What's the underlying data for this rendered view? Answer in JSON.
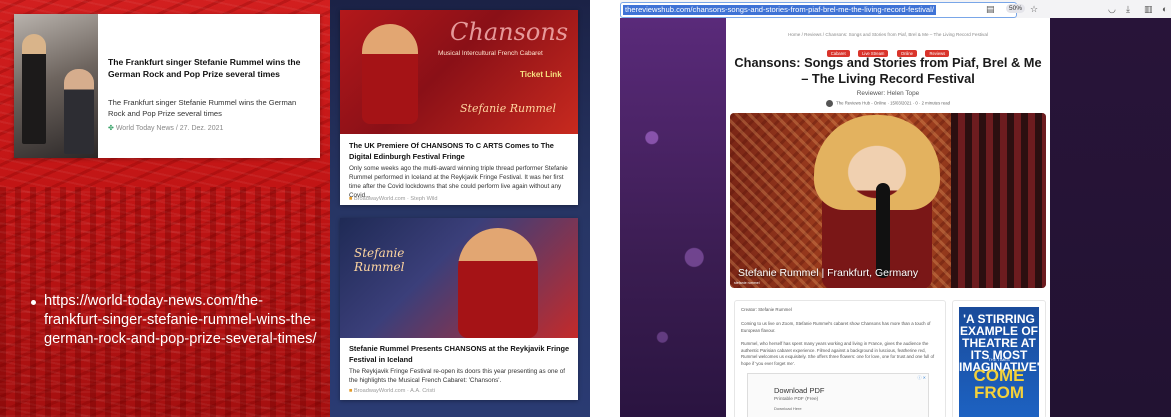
{
  "left_slide": {
    "top_card": {
      "title": "The Frankfurt singer Stefanie Rummel wins the German Rock and Pop Prize several times",
      "description": "The Frankfurt singer Stefanie Rummel wins the German Rock and Pop Prize several times",
      "source": "World Today News",
      "date": "27. Dez. 2021"
    },
    "bullet_link": "https://world-today-news.com/the-frankfurt-singer-stefanie-rummel-wins-the-german-rock-and-pop-prize-several-times/",
    "card1": {
      "image_brand": "Chansons",
      "image_subtitle": "Musical Intercultural French Cabaret",
      "image_ticket": "Ticket Link",
      "image_signature": "Stefanie Rummel",
      "title": "The UK Premiere Of CHANSONS To C ARTS Comes to The Digital Edinburgh Festival Fringe",
      "description": "Only some weeks ago the multi-award winning triple thread performer Stefanie Rummel performed in Iceland at the Reykjavik Fringe Festival. It was her first time after the Covid lockdowns that she could perform live again without any Covid...",
      "source": "BroadwayWorld.com · Steph Wild"
    },
    "card2": {
      "image_signature": "Stefanie Rummel",
      "title": "Stefanie Rummel Presents CHANSONS at the Reykjavik Fringe Festival in Iceland",
      "description": "The Reykjavik Fringe Festival re-open its doors this year presenting as one of the highlights the Musical French Cabaret: 'Chansons'.",
      "source": "BroadwayWorld.com · A.A. Cristi"
    }
  },
  "browser": {
    "url": "thereviewshub.com/chansons-songs-and-stories-from-piaf-brel-me-the-living-record-festival/",
    "zoom": "50%",
    "page": {
      "breadcrumb": "Home / Reviews / Chansons: Songs and Stories from Piaf, Brel & Me – The Living Record Festival",
      "tags": [
        "Cabaret",
        "Live Stream",
        "Online",
        "Reviews"
      ],
      "title": "Chansons: Songs and Stories from Piaf, Brel & Me – The Living Record Festival",
      "reviewer": "Reviewer: Helen Tope",
      "meta": "The Reviews Hub - Online · 15/03/2021 · 0 · 2 minutes read",
      "hero_caption": "Stefanie Rummel | Frankfurt, Germany",
      "hero_logo": "stefanie rummel",
      "credit": "Creator: Stefanie Rummel",
      "para1": "Coming to us live on Zoom, Stefanie Rummel's cabaret show Chansons has more than a touch of European flavour.",
      "para2": "Rummel, who herself has spent many years working and living in France, gives the audience the authentic Parisian cabaret experience. Filmed against a background in luscious, featherine red, Rummel welcomes us exquisitely. She offers three flowers: one for love, one for trust and one full of hope if 'you ever forget me'.",
      "ad": {
        "title": "Download PDF",
        "subtitle": "Printable PDF (Free)",
        "button": "Download Here",
        "mark": "ⓘ ✕"
      },
      "poster": {
        "line1": "'A STIRRING EXAMPLE OF THEATRE AT ITS MOST IMAGINATIVE'",
        "line2": "THE TIMES",
        "line3": "COME FROM"
      }
    }
  }
}
